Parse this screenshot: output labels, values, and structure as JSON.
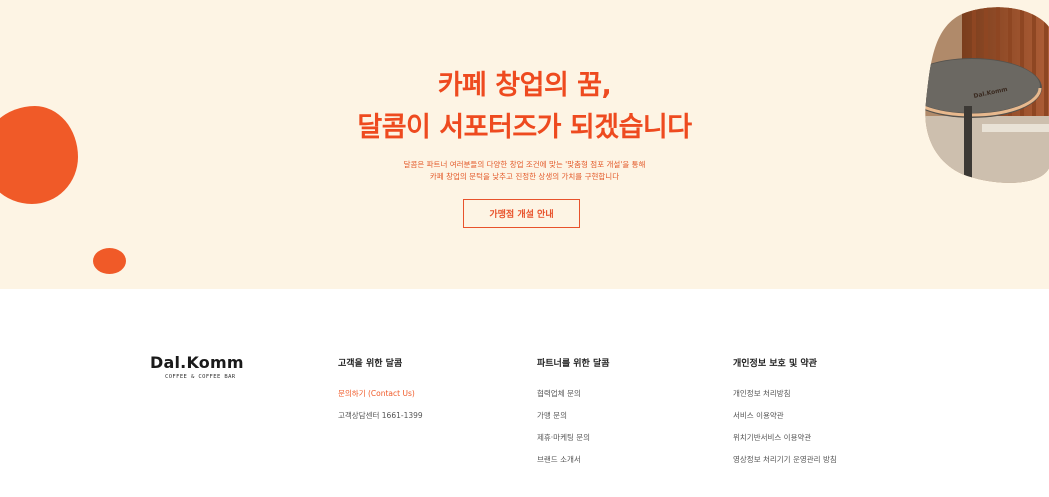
{
  "hero": {
    "title_line1": "카페 창업의 꿈,",
    "title_line2": "달콤이 서포터즈가 되겠습니다",
    "desc_line1": "달콤은 파트너 여러분들의 다양한 창업 조건에 맞는 '맞춤형 점포 개설'을 통해",
    "desc_line2": "카페 창업의 문턱을 낮추고 진정한 상생의 가치를 구현합니다",
    "button_label": "가맹점 개설 안내",
    "photo_cup_text": "Dal.Komm"
  },
  "footer": {
    "logo": "Dal.Komm",
    "logo_sub": "COFFEE & COFFEE BAR",
    "columns": [
      {
        "title": "고객을 위한 달콤",
        "items": [
          "문의하기 (Contact Us)",
          "고객상담센터 1661-1399"
        ]
      },
      {
        "title": "파트너를 위한 달콤",
        "items": [
          "협력업체 문의",
          "가맹 문의",
          "제휴·마케팅 문의",
          "브랜드 소개서"
        ]
      },
      {
        "title": "개인정보 보호 및 약관",
        "items": [
          "개인정보 처리방침",
          "서비스 이용약관",
          "위치기반서비스 이용약관",
          "영상정보 처리기기 운영관리 방침"
        ]
      }
    ]
  },
  "colors": {
    "accent": "#f05a28",
    "hero_bg": "#fdf4e4"
  }
}
